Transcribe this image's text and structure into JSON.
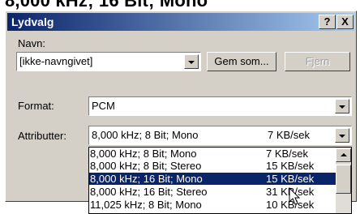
{
  "caption": "8,000 kHz; 16 Bit; Mono",
  "window": {
    "title": "Lydvalg",
    "help_label": "?",
    "close_label": "X"
  },
  "navn": {
    "label": "Navn:",
    "value": "[ikke-navngivet]",
    "save_as": "Gem som...",
    "remove": "Fjern"
  },
  "format": {
    "label": "Format:",
    "value": "PCM"
  },
  "attributes": {
    "label": "Attributter:",
    "selected_format": "8,000 kHz; 8 Bit; Mono",
    "selected_rate": "7 KB/sek",
    "options": [
      {
        "format": "8,000 kHz; 8 Bit; Mono",
        "rate": "7 KB/sek"
      },
      {
        "format": "8,000 kHz; 8 Bit; Stereo",
        "rate": "15 KB/sek"
      },
      {
        "format": "8,000 kHz; 16 Bit; Mono",
        "rate": "15 KB/sek"
      },
      {
        "format": "8,000 kHz; 16 Bit; Stereo",
        "rate": "31 KB/sek"
      },
      {
        "format": "11,025 kHz; 8 Bit; Mono",
        "rate": "10 KB/sek"
      }
    ]
  },
  "colors": {
    "titlebar_start": "#0a246a",
    "titlebar_end": "#a6caf0",
    "selection": "#0a246a",
    "face": "#d4d0c8"
  }
}
